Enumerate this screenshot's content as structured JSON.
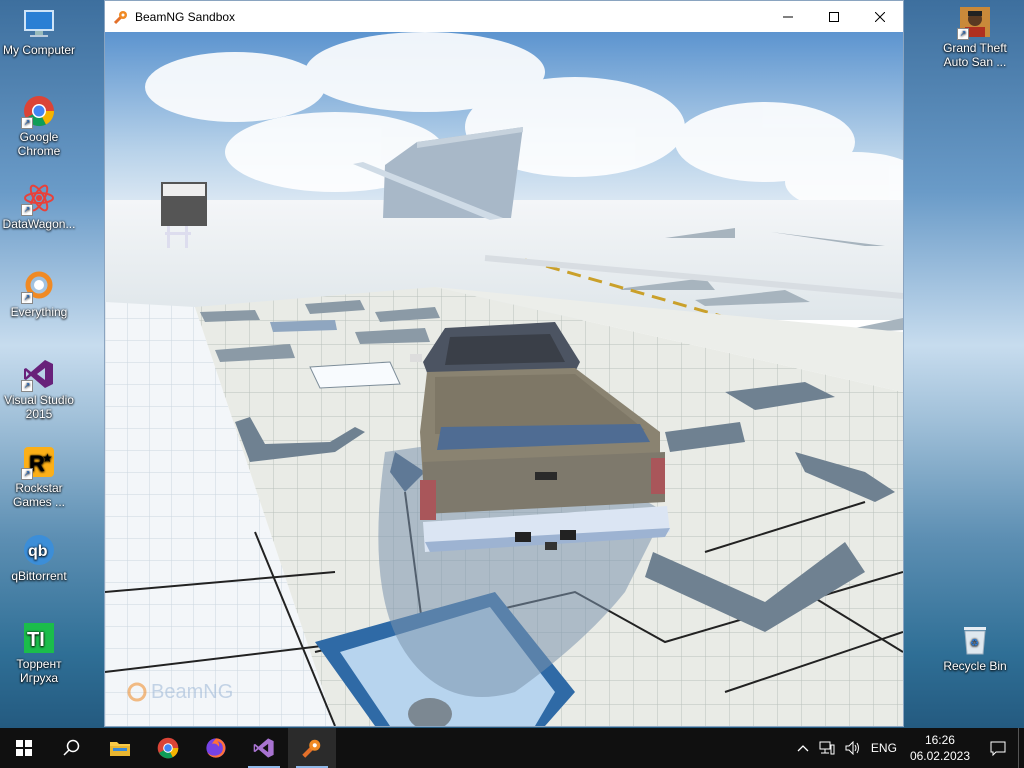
{
  "desktop": {
    "left_icons": [
      {
        "label": "My Computer"
      },
      {
        "label": "Google Chrome"
      },
      {
        "label": "DataWagon..."
      },
      {
        "label": "Everything"
      },
      {
        "label": "Visual Studio 2015"
      },
      {
        "label": "Rockstar Games ..."
      },
      {
        "label": "qBittorrent"
      },
      {
        "label": "Торрент Игруха"
      }
    ],
    "right_icons": [
      {
        "label": "Grand Theft Auto San ..."
      },
      {
        "label": "Recycle Bin"
      }
    ]
  },
  "window": {
    "title": "BeamNG Sandbox",
    "watermark": "BeamNG"
  },
  "taskbar": {
    "language": "ENG",
    "time": "16:26",
    "date": "06.02.2023"
  }
}
